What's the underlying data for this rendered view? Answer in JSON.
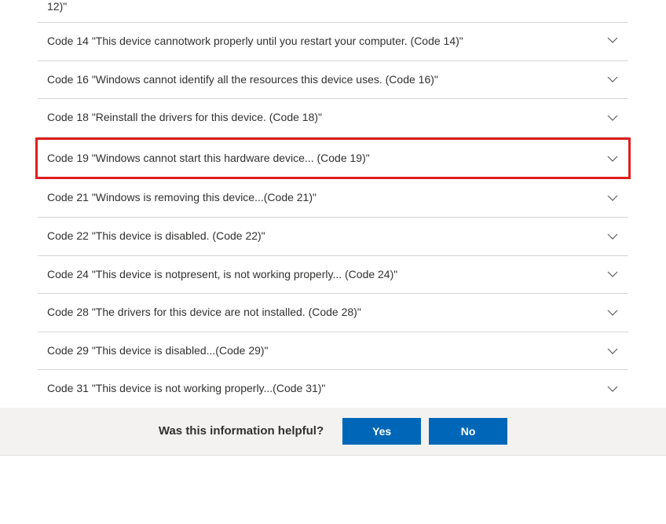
{
  "list": {
    "partial_top": "12)\"",
    "items": [
      {
        "label": "Code 14 \"This device cannotwork properly until you restart your computer. (Code 14)\"",
        "highlighted": false,
        "first": true
      },
      {
        "label": "Code 16 \"Windows cannot identify all the resources this device uses. (Code 16)\"",
        "highlighted": false
      },
      {
        "label": "Code 18 \"Reinstall the drivers for this device. (Code 18)\"",
        "highlighted": false
      },
      {
        "label": "Code 19 \"Windows cannot start this hardware device... (Code 19)\"",
        "highlighted": true
      },
      {
        "label": "Code 21 \"Windows is removing this device...(Code 21)\"",
        "highlighted": false
      },
      {
        "label": "Code 22 \"This device is disabled. (Code 22)\"",
        "highlighted": false
      },
      {
        "label": "Code 24 \"This device is notpresent, is not working properly... (Code 24)\"",
        "highlighted": false
      },
      {
        "label": "Code 28 \"The drivers for this device are not installed. (Code 28)\"",
        "highlighted": false
      },
      {
        "label": "Code 29 \"This device is disabled...(Code 29)\"",
        "highlighted": false
      },
      {
        "label": "Code 31 \"This device is not working properly...(Code 31)\"",
        "highlighted": false
      }
    ]
  },
  "feedback": {
    "prompt": "Was this information helpful?",
    "yes": "Yes",
    "no": "No"
  },
  "colors": {
    "highlight_border": "#e01e1e",
    "button_bg": "#0067b8",
    "bar_bg": "#f3f2f1"
  }
}
